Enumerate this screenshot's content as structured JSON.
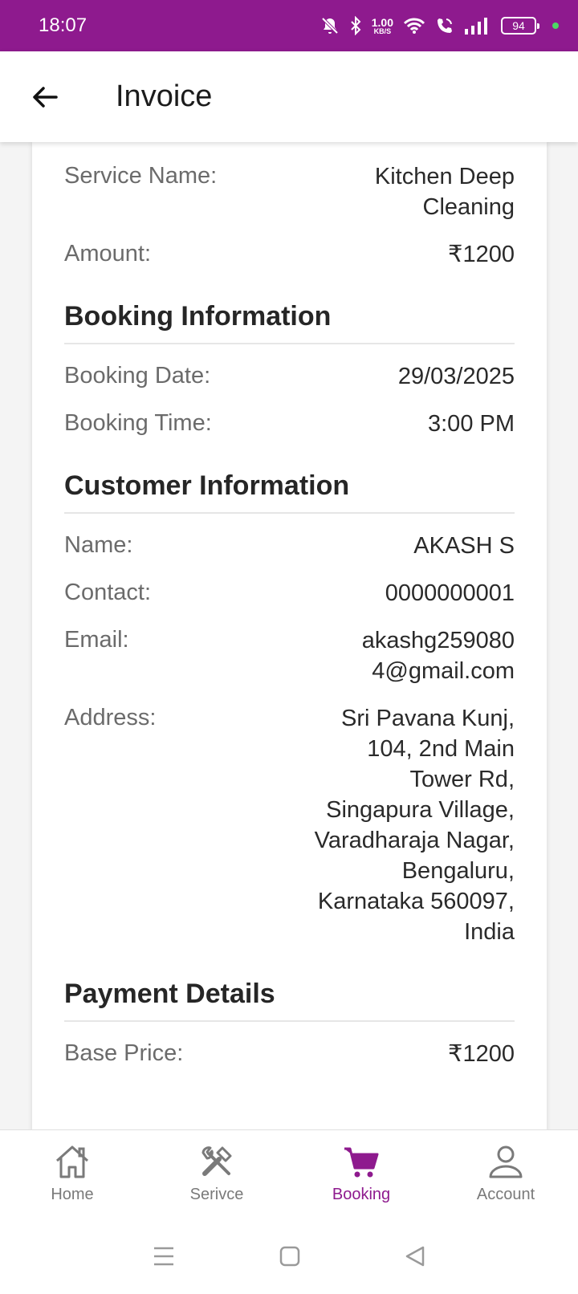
{
  "status_bar": {
    "time": "18:07",
    "speed_value": "1.00",
    "speed_unit": "KB/S",
    "battery": "94",
    "colors": {
      "background": "#8e1a8e",
      "charging_dot": "#4cd964"
    },
    "icons": [
      "mute-bell-icon",
      "bluetooth-icon",
      "wifi-icon",
      "wifi-calling-icon",
      "signal-icon",
      "battery-icon"
    ]
  },
  "app_bar": {
    "title": "Invoice",
    "back_icon": "arrow-left-icon"
  },
  "service": {
    "name_label": "Service Name:",
    "name_value": "Kitchen Deep Cleaning",
    "amount_label": "Amount:",
    "amount_value": "₹1200"
  },
  "booking": {
    "title": "Booking Information",
    "date_label": "Booking Date:",
    "date_value": "29/03/2025",
    "time_label": "Booking Time:",
    "time_value": "3:00 PM"
  },
  "customer": {
    "title": "Customer Information",
    "name_label": "Name:",
    "name_value": "AKASH S",
    "contact_label": "Contact:",
    "contact_value": "0000000001",
    "email_label": "Email:",
    "email_value": "akashg2590804@gmail.com",
    "address_label": "Address:",
    "address_value": "Sri Pavana Kunj, 104, 2nd Main Tower Rd, Singapura Village, Varadharaja Nagar, Bengaluru, Karnataka 560097, India"
  },
  "payment": {
    "title": "Payment Details",
    "base_price_label": "Base Price:",
    "base_price_value": "₹1200"
  },
  "bottom_nav": {
    "active_color": "#8e1a8e",
    "items": [
      {
        "label": "Home",
        "icon": "home-icon"
      },
      {
        "label": "Serivce",
        "icon": "tools-icon"
      },
      {
        "label": "Booking",
        "icon": "cart-icon"
      },
      {
        "label": "Account",
        "icon": "user-icon"
      }
    ]
  },
  "system_nav": {
    "icons": [
      "menu-icon",
      "home-square-icon",
      "back-triangle-icon"
    ]
  }
}
